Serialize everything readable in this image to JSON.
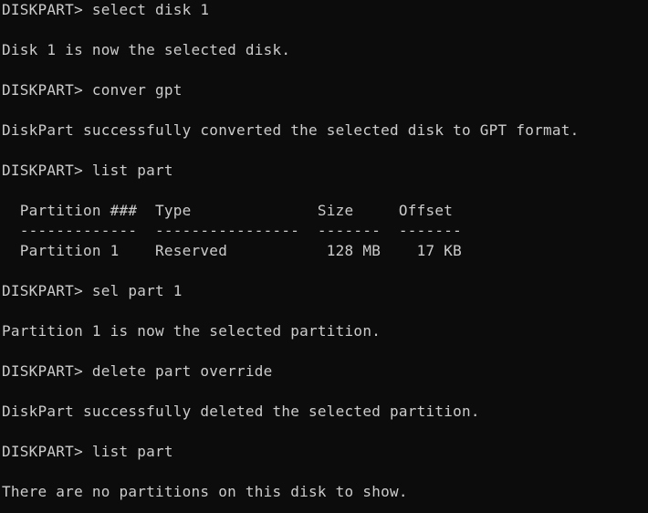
{
  "console": {
    "colors": {
      "background": "#0c0c0c",
      "text": "#cccccc"
    },
    "lines": [
      "DISKPART> select disk 1",
      "Disk 1 is now the selected disk.",
      "DISKPART> conver gpt",
      "DiskPart successfully converted the selected disk to GPT format.",
      "DISKPART> list part",
      "  Partition ###  Type              Size     Offset",
      "  -------------  ----------------  -------  -------",
      "  Partition 1    Reserved           128 MB    17 KB",
      "DISKPART> sel part 1",
      "Partition 1 is now the selected partition.",
      "DISKPART> delete part override",
      "DiskPart successfully deleted the selected partition.",
      "DISKPART> list part",
      "There are no partitions on this disk to show."
    ]
  }
}
